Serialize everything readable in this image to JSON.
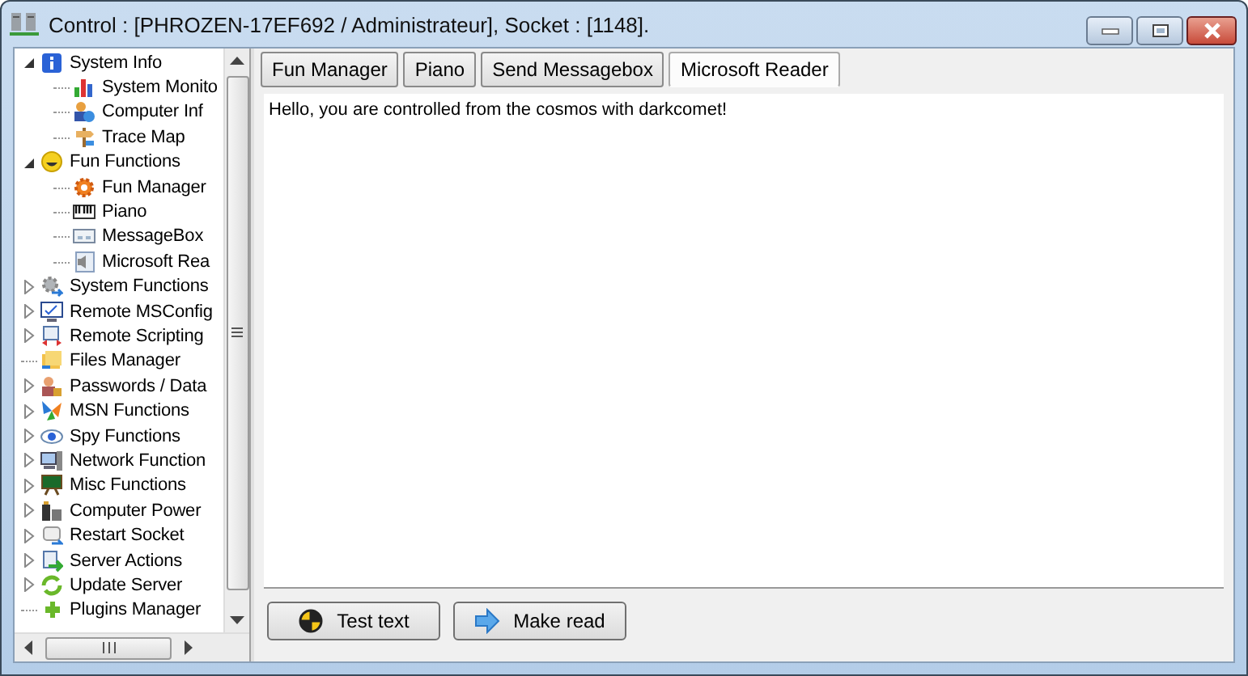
{
  "window": {
    "title": "Control : [PHROZEN-17EF692 / Administrateur], Socket : [1148]."
  },
  "tree": [
    {
      "label": "System Info",
      "expanded": true,
      "children": [
        {
          "label": "System Monito"
        },
        {
          "label": "Computer Inf"
        },
        {
          "label": "Trace Map"
        }
      ]
    },
    {
      "label": "Fun Functions",
      "expanded": true,
      "children": [
        {
          "label": "Fun Manager"
        },
        {
          "label": "Piano"
        },
        {
          "label": "MessageBox"
        },
        {
          "label": "Microsoft Rea"
        }
      ]
    },
    {
      "label": "System Functions",
      "expanded": false
    },
    {
      "label": "Remote MSConfig",
      "expanded": false
    },
    {
      "label": "Remote Scripting",
      "expanded": false
    },
    {
      "label": "Files Manager"
    },
    {
      "label": "Passwords / Data",
      "expanded": false
    },
    {
      "label": "MSN Functions",
      "expanded": false
    },
    {
      "label": "Spy Functions",
      "expanded": false
    },
    {
      "label": "Network Function",
      "expanded": false
    },
    {
      "label": "Misc Functions",
      "expanded": false
    },
    {
      "label": "Computer Power",
      "expanded": false
    },
    {
      "label": "Restart Socket",
      "expanded": false
    },
    {
      "label": "Server Actions",
      "expanded": false
    },
    {
      "label": "Update Server",
      "expanded": false
    },
    {
      "label": "Plugins Manager"
    }
  ],
  "tabs": [
    {
      "label": "Fun Manager",
      "selected": false
    },
    {
      "label": "Piano",
      "selected": false
    },
    {
      "label": "Send Messagebox",
      "selected": false
    },
    {
      "label": "Microsoft Reader",
      "selected": true
    }
  ],
  "memo": {
    "value": "Hello, you are controlled from the cosmos with darkcomet!"
  },
  "buttons": [
    {
      "label": "Test text",
      "kind": "target"
    },
    {
      "label": "Make read",
      "kind": "arrow"
    }
  ]
}
